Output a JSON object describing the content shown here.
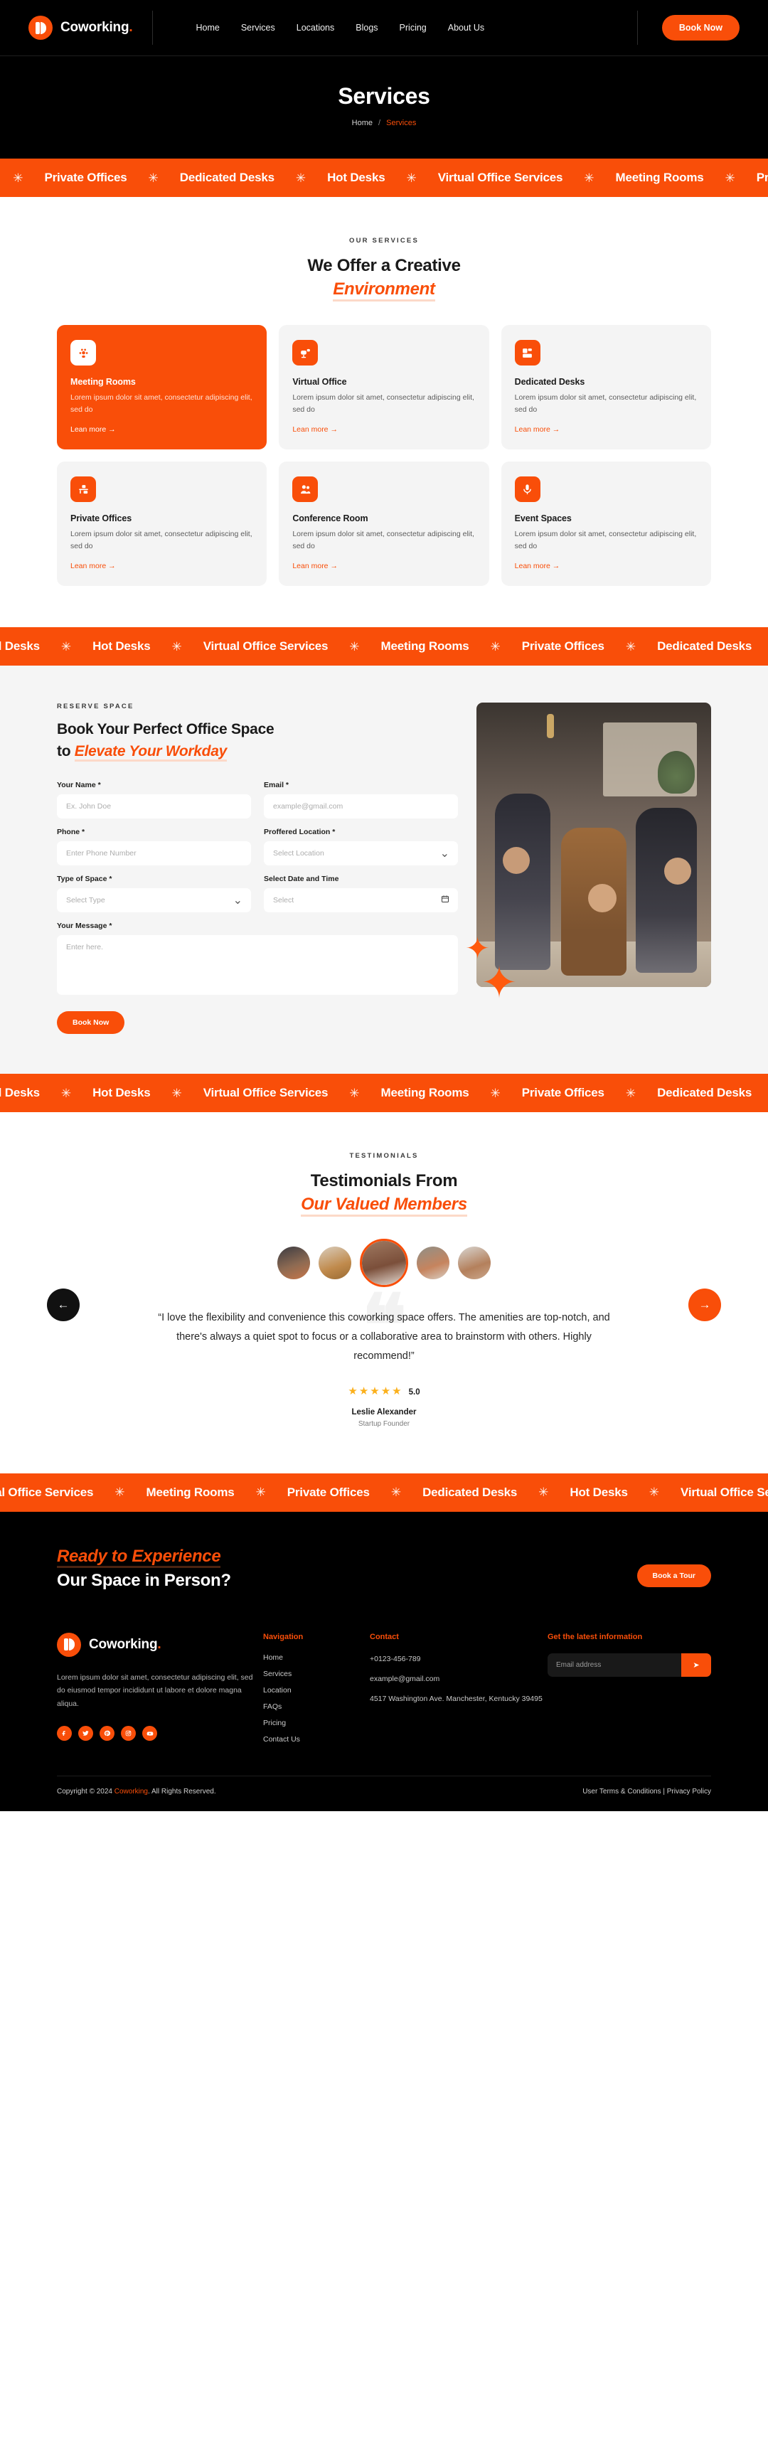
{
  "brand": {
    "name": "Coworking",
    "dot": "."
  },
  "header": {
    "nav": [
      {
        "label": "Home"
      },
      {
        "label": "Services"
      },
      {
        "label": "Locations"
      },
      {
        "label": "Blogs"
      },
      {
        "label": "Pricing"
      },
      {
        "label": "About Us"
      }
    ],
    "cta": "Book Now"
  },
  "hero": {
    "title": "Services",
    "crumb_home": "Home",
    "crumb_sep": "/",
    "crumb_current": "Services"
  },
  "marquee": {
    "items": [
      "Meeting Rooms",
      "Private Offices",
      "Dedicated Desks",
      "Hot Desks",
      "Virtual Office Services"
    ],
    "star": "✳"
  },
  "services": {
    "eyebrow": "OUR SERVICES",
    "title_line1": "We Offer a Creative",
    "title_accent": "Environment",
    "link_label": "Lean more  →",
    "cards": [
      {
        "title": "Meeting Rooms",
        "desc": "Lorem ipsum dolor sit amet, consectetur adipiscing elit, sed do",
        "icon": "people-group-icon"
      },
      {
        "title": "Virtual Office",
        "desc": "Lorem ipsum dolor sit amet, consectetur adipiscing elit, sed do",
        "icon": "monitor-chair-icon"
      },
      {
        "title": "Dedicated Desks",
        "desc": "Lorem ipsum dolor sit amet, consectetur adipiscing elit, sed do",
        "icon": "desk-window-icon"
      },
      {
        "title": "Private Offices",
        "desc": "Lorem ipsum dolor sit amet, consectetur adipiscing elit, sed do",
        "icon": "office-desk-icon"
      },
      {
        "title": "Conference Room",
        "desc": "Lorem ipsum dolor sit amet, consectetur adipiscing elit, sed do",
        "icon": "two-people-icon"
      },
      {
        "title": "Event Spaces",
        "desc": "Lorem ipsum dolor sit amet, consectetur adipiscing elit, sed do",
        "icon": "microphone-icon"
      }
    ]
  },
  "booking": {
    "eyebrow": "RESERVE SPACE",
    "title_line1": "Book Your Perfect Office Space",
    "title_line2_prefix": "to ",
    "title_accent": "Elevate Your Workday",
    "fields": {
      "name_label": "Your Name *",
      "name_ph": "Ex. John Doe",
      "email_label": "Email *",
      "email_ph": "example@gmail.com",
      "phone_label": "Phone *",
      "phone_ph": "Enter Phone Number",
      "location_label": "Proffered Location *",
      "location_ph": "Select Location",
      "type_label": "Type of Space *",
      "type_ph": "Select Type",
      "date_label": "Select Date and Time",
      "date_ph": "Select",
      "message_label": "Your Message *",
      "message_ph": "Enter here."
    },
    "submit": "Book Now"
  },
  "testimonials": {
    "eyebrow": "TESTIMONIALS",
    "title_line1": "Testimonials From",
    "title_accent": "Our Valued Members",
    "quote": "“I love the flexibility and convenience this coworking space offers. The amenities are top-notch, and there's always a quiet spot to focus or a collaborative area to brainstorm with others. Highly recommend!”",
    "stars": "★★★★★",
    "score": "5.0",
    "author": "Leslie Alexander",
    "role": "Startup Founder",
    "prev": "←",
    "next": "→"
  },
  "cta": {
    "accent": "Ready to Experience",
    "line2": "Our Space in Person?",
    "button": "Book a Tour"
  },
  "footer": {
    "desc": "Lorem ipsum dolor sit amet, consectetur adipiscing elit, sed do eiusmod tempor incididunt ut labore et dolore magna aliqua.",
    "socials": [
      "facebook-icon",
      "twitter-icon",
      "pinterest-icon",
      "instagram-icon",
      "youtube-icon"
    ],
    "nav_heading": "Navigation",
    "nav_links": [
      {
        "label": "Home"
      },
      {
        "label": "Services"
      },
      {
        "label": "Location"
      },
      {
        "label": "FAQs"
      },
      {
        "label": "Pricing"
      },
      {
        "label": "Contact Us"
      }
    ],
    "contact_heading": "Contact",
    "phone": "+0123-456-789",
    "email": "example@gmail.com",
    "address": "4517 Washington Ave. Manchester, Kentucky 39495",
    "news_heading": "Get the latest information",
    "news_ph": "Email address",
    "news_btn": "➤",
    "copyright_pre": "Copyright © 2024 ",
    "copyright_brand": "Coworking",
    "copyright_post": ". All Rights Reserved.",
    "legal": "User Terms & Conditions | Privacy Policy"
  },
  "colors": {
    "accent": "#f94e09",
    "dark": "#000000",
    "star": "#fbb01c"
  }
}
